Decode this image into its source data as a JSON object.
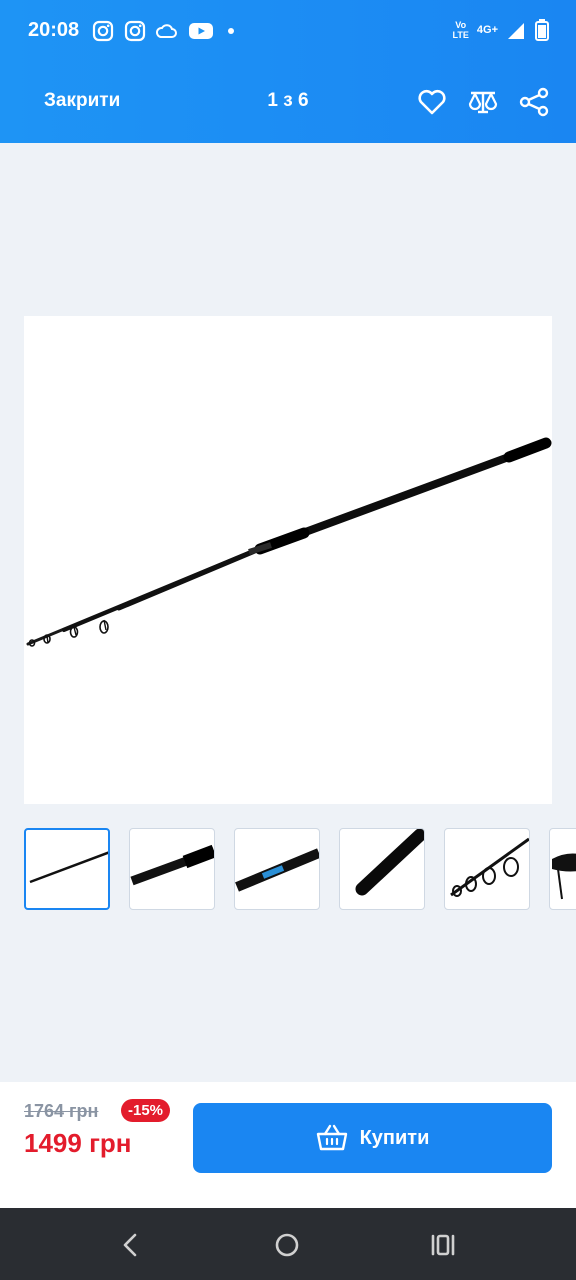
{
  "status_bar": {
    "time": "20:08",
    "volte_top": "Vo",
    "volte_bottom": "LTE",
    "network": "4G+",
    "icons": [
      "instagram-icon",
      "instagram-icon",
      "cloud-icon",
      "youtube-icon",
      "dot-icon",
      "signal-icon",
      "battery-icon"
    ]
  },
  "header": {
    "close_label": "Закрити",
    "counter": "1 з 6",
    "icons": [
      "heart-icon",
      "compare-icon",
      "share-icon"
    ]
  },
  "gallery": {
    "current_index": 1,
    "total": 6,
    "thumbnails": [
      {
        "name": "rod-full",
        "active": true
      },
      {
        "name": "rod-reel-seat",
        "active": false
      },
      {
        "name": "rod-label",
        "active": false
      },
      {
        "name": "rod-handle",
        "active": false
      },
      {
        "name": "rod-guides",
        "active": false
      },
      {
        "name": "rod-cap",
        "active": false
      }
    ]
  },
  "purchase": {
    "old_price": "1764 грн",
    "discount": "-15%",
    "price": "1499 грн",
    "buy_label": "Купити"
  },
  "colors": {
    "accent": "#1a86f2",
    "sale": "#e31c2c",
    "navbar": "#2a2d32"
  }
}
